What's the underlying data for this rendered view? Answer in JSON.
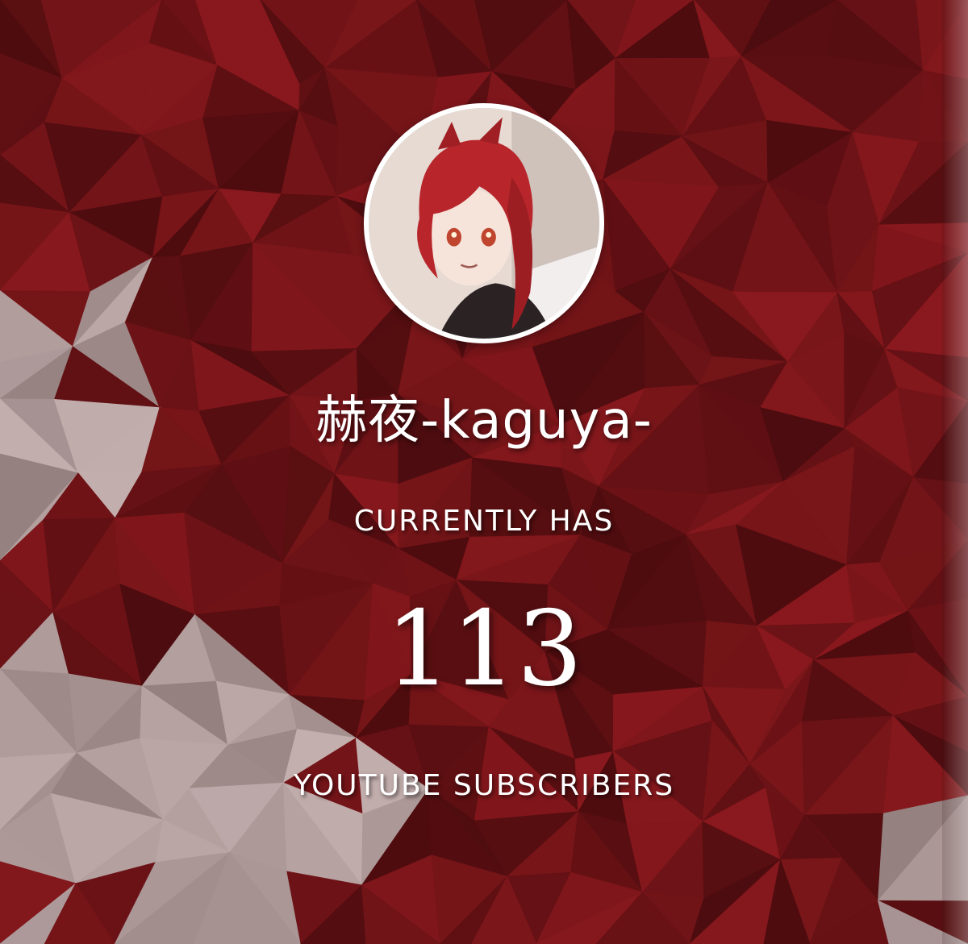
{
  "channel": {
    "name": "赫夜-kaguya-",
    "avatar_icon": "channel-avatar-anime-character"
  },
  "stats": {
    "prefix_label": "CURRENTLY HAS",
    "count": "113",
    "suffix_label": "YOUTUBE SUBSCRIBERS"
  },
  "colors": {
    "background_dark": "#4a1418",
    "background_mid": "#7a2326",
    "background_light": "#b7aca8",
    "text": "#ffffff"
  }
}
